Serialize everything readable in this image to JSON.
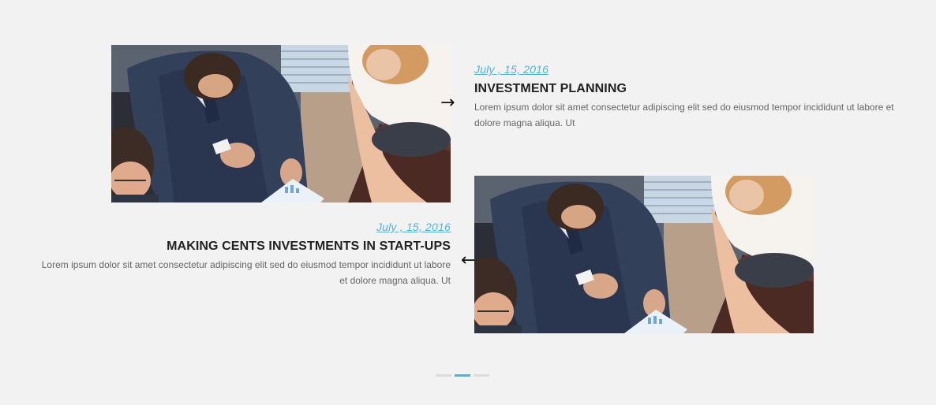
{
  "posts": [
    {
      "date": "July , 15, 2016",
      "title": "INVESTMENT PLANNING",
      "excerpt": "Lorem ipsum dolor sit amet consectetur adipiscing elit sed do eiusmod tempor incididunt ut labore et dolore magna aliqua. Ut",
      "image_icon": "business-meeting-photo",
      "arrow": "→"
    },
    {
      "date": "July , 15, 2016",
      "title": "MAKING CENTS INVESTMENTS IN START-UPS",
      "excerpt": "Lorem ipsum dolor sit amet consectetur adipiscing elit sed do eiusmod tempor incididunt ut labore et dolore magna aliqua. Ut",
      "image_icon": "business-meeting-photo",
      "arrow": "←"
    }
  ],
  "pagination": {
    "count": 3,
    "active_index": 1
  },
  "colors": {
    "background": "#f2f2f2",
    "accent": "#4fb3d9",
    "title": "#222222",
    "text": "#666666"
  }
}
